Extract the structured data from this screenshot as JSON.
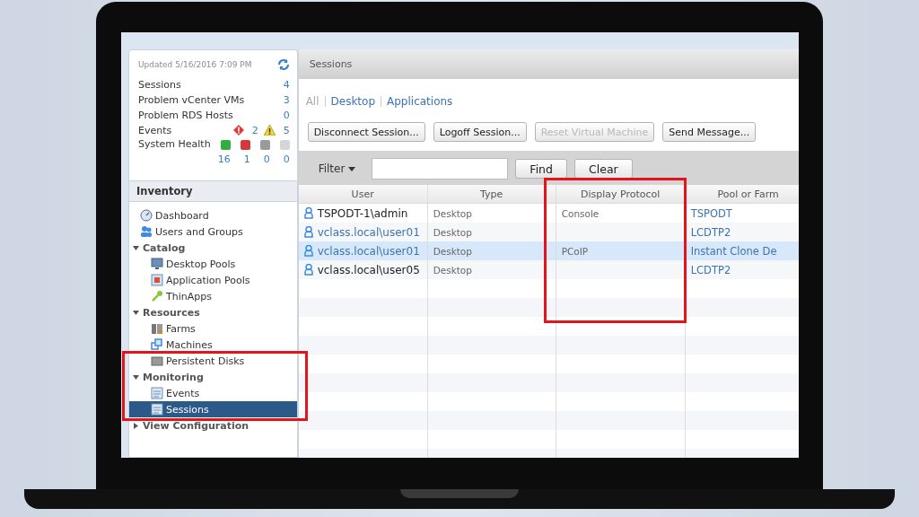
{
  "sidebar": {
    "updated": "Updated 5/16/2016 7:09 PM",
    "stats": [
      {
        "label": "Sessions",
        "value": "4"
      },
      {
        "label": "Problem vCenter VMs",
        "value": "3"
      },
      {
        "label": "Problem RDS Hosts",
        "value": "0"
      }
    ],
    "events": {
      "label": "Events",
      "errors": "2",
      "warnings": "5"
    },
    "health": {
      "label": "System Health",
      "counts": [
        {
          "value": "16",
          "color": "#2eae3c"
        },
        {
          "value": "1",
          "color": "#d23a3a"
        },
        {
          "value": "0",
          "color": "#9a9a9a"
        },
        {
          "value": "0",
          "color": "#d6d6d6"
        }
      ]
    },
    "inventory_title": "Inventory",
    "tree": [
      {
        "label": "Dashboard",
        "kind": "gauge",
        "selected": false
      },
      {
        "label": "Users and Groups",
        "kind": "users",
        "selected": false
      },
      {
        "label": "Catalog",
        "kind": "group",
        "expanded": true,
        "highlighted": false,
        "children": [
          {
            "label": "Desktop Pools",
            "kind": "monitor",
            "selected": false
          },
          {
            "label": "Application Pools",
            "kind": "app",
            "selected": false
          },
          {
            "label": "ThinApps",
            "kind": "key",
            "selected": false
          }
        ]
      },
      {
        "label": "Resources",
        "kind": "group",
        "expanded": true,
        "highlighted": false,
        "children": [
          {
            "label": "Farms",
            "kind": "server",
            "selected": false
          },
          {
            "label": "Machines",
            "kind": "machines",
            "selected": false
          },
          {
            "label": "Persistent Disks",
            "kind": "disk",
            "selected": false
          }
        ]
      },
      {
        "label": "Monitoring",
        "kind": "group",
        "expanded": true,
        "highlighted": true,
        "children": [
          {
            "label": "Events",
            "kind": "list",
            "selected": false
          },
          {
            "label": "Sessions",
            "kind": "list",
            "selected": true
          }
        ]
      },
      {
        "label": "View Configuration",
        "kind": "group",
        "expanded": false,
        "highlighted": false
      }
    ]
  },
  "main": {
    "title": "Sessions",
    "filters": [
      {
        "label": "All",
        "selected": true
      },
      {
        "label": "Desktop",
        "selected": false
      },
      {
        "label": "Applications",
        "selected": false
      }
    ],
    "actions": [
      {
        "label": "Disconnect Session...",
        "disabled": false
      },
      {
        "label": "Logoff Session...",
        "disabled": false
      },
      {
        "label": "Reset Virtual Machine",
        "disabled": true
      },
      {
        "label": "Send Message...",
        "disabled": false
      }
    ],
    "filter_label": "Filter",
    "find": "Find",
    "clear": "Clear",
    "columns": [
      {
        "label": "User",
        "highlighted": false
      },
      {
        "label": "Type",
        "highlighted": false
      },
      {
        "label": "Display Protocol",
        "highlighted": true
      },
      {
        "label": "Pool or Farm",
        "highlighted": false
      }
    ],
    "rows": [
      {
        "selected": false,
        "kind": "plain",
        "cells": [
          "TSPODT-1\\admin",
          "Desktop",
          "Console",
          "TSPODT"
        ]
      },
      {
        "selected": false,
        "kind": "link",
        "cells": [
          "vclass.local\\user01",
          "Desktop",
          "",
          "LCDTP2"
        ]
      },
      {
        "selected": true,
        "kind": "link",
        "cells": [
          "vclass.local\\user01",
          "Desktop",
          "PCoIP",
          "Instant Clone De"
        ]
      },
      {
        "selected": false,
        "kind": "plain",
        "cells": [
          "vclass.local\\user05",
          "Desktop",
          "",
          "LCDTP2"
        ]
      }
    ]
  }
}
